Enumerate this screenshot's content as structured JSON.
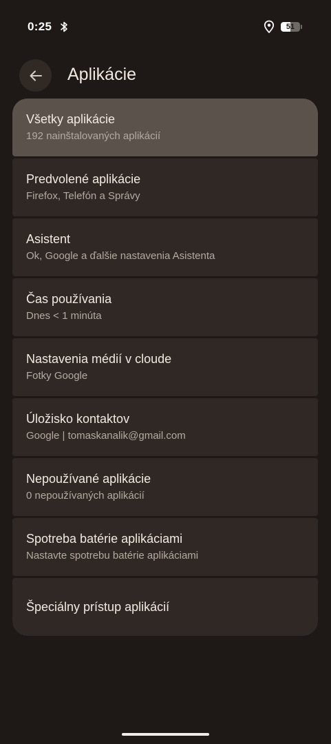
{
  "status_bar": {
    "time": "0:25",
    "battery_level": "51",
    "battery_fraction": 0.51,
    "icons": [
      "bluetooth-icon",
      "location-icon",
      "battery-icon"
    ]
  },
  "header": {
    "back_icon": "arrow-left-icon",
    "title": "Aplikácie"
  },
  "items": [
    {
      "title": "Všetky aplikácie",
      "subtitle": "192 nainštalovaných aplikácií"
    },
    {
      "title": "Predvolené aplikácie",
      "subtitle": "Firefox, Telefón a Správy"
    },
    {
      "title": "Asistent",
      "subtitle": "Ok, Google a ďalšie nastavenia Asistenta"
    },
    {
      "title": "Čas používania",
      "subtitle": "Dnes < 1 minúta"
    },
    {
      "title": "Nastavenia médií v cloude",
      "subtitle": "Fotky Google"
    },
    {
      "title": "Úložisko kontaktov",
      "subtitle": "Google | tomaskanalik@gmail.com"
    },
    {
      "title": "Nepoužívané aplikácie",
      "subtitle": "0 nepoužívaných aplikácií"
    },
    {
      "title": "Spotreba batérie aplikáciami",
      "subtitle": "Nastavte spotrebu batérie aplikáciami"
    },
    {
      "title": "Špeciálny prístup aplikácií"
    }
  ],
  "colors": {
    "background": "#1e1916",
    "card": "#2f2824",
    "card_highlight": "#5a524b",
    "text_primary": "#f2e9e1",
    "text_secondary": "#b4aaa1"
  }
}
